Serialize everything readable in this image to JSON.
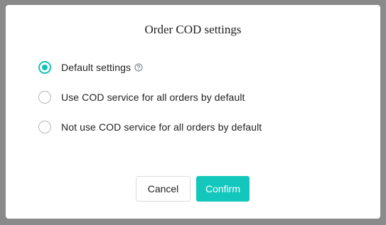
{
  "dialog": {
    "title": "Order COD settings",
    "options": [
      {
        "label": "Default settings",
        "selected": true,
        "has_help_icon": true
      },
      {
        "label": "Use COD service for all orders by default",
        "selected": false
      },
      {
        "label": "Not use COD service for all orders by default",
        "selected": false
      }
    ],
    "buttons": {
      "cancel_label": "Cancel",
      "confirm_label": "Confirm"
    }
  },
  "colors": {
    "accent": "#13c2b7",
    "confirm_button": "#13c7bd",
    "backdrop": "#8a8a8a"
  },
  "icons": {
    "help": "question-circle-icon"
  }
}
